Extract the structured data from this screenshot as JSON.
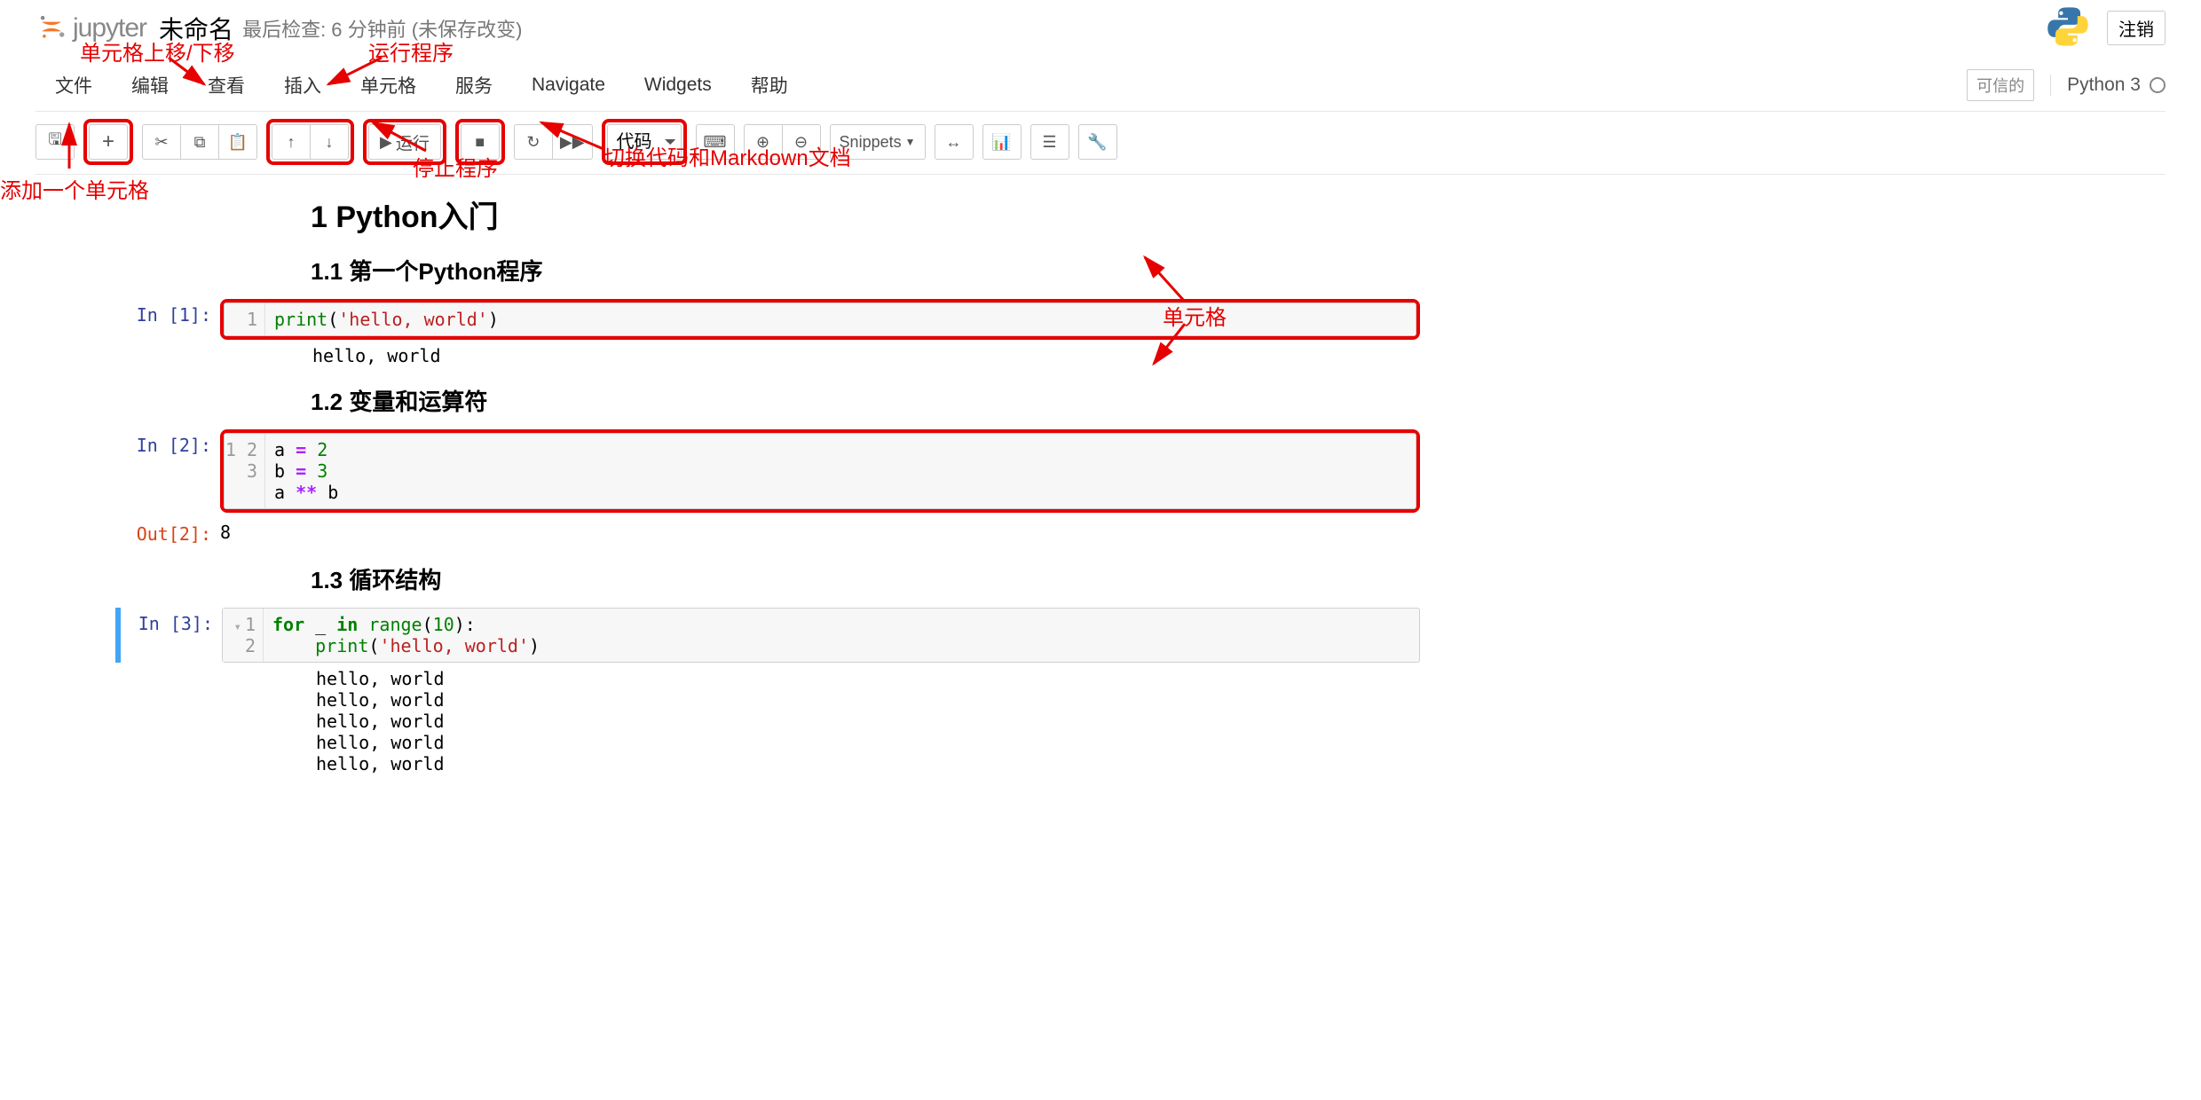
{
  "header": {
    "logo_text": "jupyter",
    "notebook_name": "未命名",
    "checkpoint": "最后检查: 6 分钟前  (未保存改变)",
    "logout": "注销"
  },
  "menu": {
    "items": [
      "文件",
      "编辑",
      "查看",
      "插入",
      "单元格",
      "服务",
      "Navigate",
      "Widgets",
      "帮助"
    ],
    "trusted": "可信的",
    "kernel": "Python 3"
  },
  "toolbar": {
    "run_label": "运行",
    "cell_type": "代码",
    "snippets_label": "Snippets"
  },
  "annotations": {
    "add_cell": "添加一个单元格",
    "move_cell": "单元格上移/下移",
    "run_program": "运行程序",
    "stop_program": "停止程序",
    "switch_md": "切换代码和Markdown文档",
    "cell_label": "单元格"
  },
  "doc": {
    "h1": "1  Python入门",
    "h2_1": "1.1  第一个Python程序",
    "h2_2": "1.2  变量和运算符",
    "h2_3": "1.3  循环结构"
  },
  "cells": [
    {
      "prompt": "In [1]:",
      "gutter": "1",
      "code_html": "<span class='s-bi'>print</span>(<span class='s-str'>'hello, world'</span>)",
      "output": "hello, world"
    },
    {
      "prompt": "In [2]:",
      "gutter": "1\n2\n3",
      "code_html": "a <span class='s-op'>=</span> <span class='s-num'>2</span>\nb <span class='s-op'>=</span> <span class='s-num'>3</span>\na <span class='s-op'>**</span> b",
      "out_prompt": "Out[2]:",
      "out_value": "8"
    },
    {
      "prompt": "In [3]:",
      "gutter": "1\n2",
      "code_html": "<span class='s-kw'>for</span> _ <span class='s-kw'>in</span> <span class='s-bi'>range</span>(<span class='s-num'>10</span>):\n    <span class='s-bi'>print</span>(<span class='s-str'>'hello, world'</span>)",
      "output": "hello, world\nhello, world\nhello, world\nhello, world\nhello, world"
    }
  ]
}
